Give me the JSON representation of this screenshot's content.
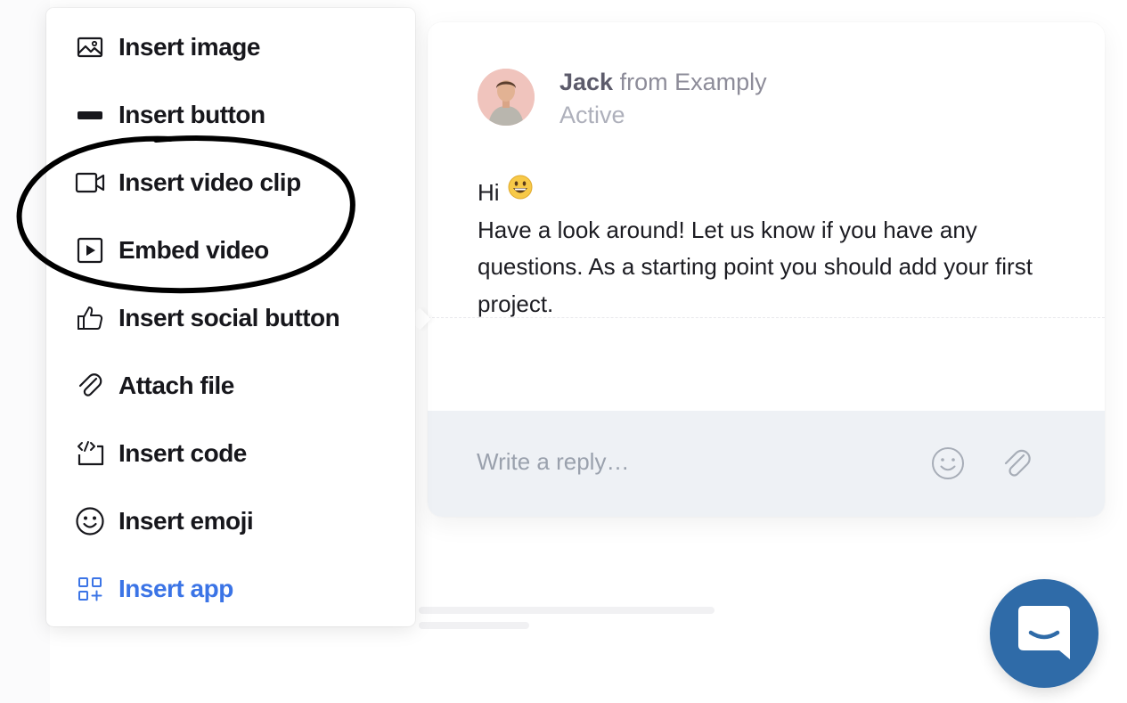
{
  "menu": {
    "items": [
      {
        "label": "Insert image",
        "icon": "image-icon"
      },
      {
        "label": "Insert button",
        "icon": "button-icon"
      },
      {
        "label": "Insert video clip",
        "icon": "video-camera-icon"
      },
      {
        "label": "Embed video",
        "icon": "play-icon"
      },
      {
        "label": "Insert social button",
        "icon": "thumbs-up-icon"
      },
      {
        "label": "Attach file",
        "icon": "paperclip-icon"
      },
      {
        "label": "Insert code",
        "icon": "code-icon"
      },
      {
        "label": "Insert emoji",
        "icon": "smiley-icon"
      },
      {
        "label": "Insert app",
        "icon": "apps-grid-icon"
      }
    ]
  },
  "chat": {
    "agent_name": "Jack",
    "agent_org": "from Examply",
    "agent_status": "Active",
    "greeting": "Hi",
    "greeting_emoji": "grinning-face-emoji",
    "message_body": "Have a look around! Let us know if you have any questions. As a starting point you should add your first project.",
    "reply_placeholder": "Write a reply…"
  },
  "launcher": {
    "icon": "chat-bubble-icon"
  },
  "colors": {
    "accent": "#3b74e6",
    "launcher": "#2f6ba8",
    "reply_bg": "#eef1f5",
    "highlight_stroke": "#000000"
  }
}
